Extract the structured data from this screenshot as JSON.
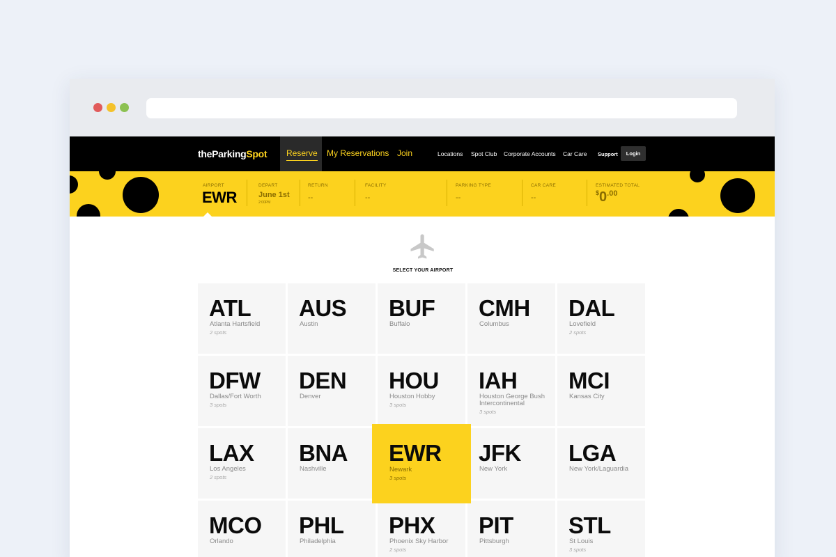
{
  "header": {
    "logo_part1": "theParking",
    "logo_part2": "Spot",
    "nav": {
      "reserve": "Reserve",
      "my_reservations": "My Reservations",
      "join": "Join"
    },
    "subnav": {
      "locations": "Locations",
      "spot_club": "Spot Club",
      "corporate": "Corporate Accounts",
      "car_care": "Car Care"
    },
    "support": "Support",
    "login": "Login"
  },
  "booking_bar": {
    "airport_label": "AIRPORT",
    "airport_value": "EWR",
    "depart_label": "DEPART",
    "depart_date": "June 1st",
    "depart_time": "2:00PM",
    "return_label": "RETURN",
    "return_value": "--",
    "facility_label": "FACILITY",
    "facility_value": "--",
    "parking_type_label": "PARKING TYPE",
    "parking_type_value": "--",
    "car_care_label": "CAR CARE",
    "car_care_value": "--",
    "total_label": "ESTIMATED TOTAL",
    "total_symbol": "$",
    "total_whole": "0",
    "total_cents": ".00"
  },
  "main": {
    "icon": "airplane-icon",
    "title": "SELECT YOUR AIRPORT",
    "airports": [
      {
        "code": "ATL",
        "city": "Atlanta Hartsfield",
        "spots": "2 spots"
      },
      {
        "code": "AUS",
        "city": "Austin",
        "spots": ""
      },
      {
        "code": "BUF",
        "city": "Buffalo",
        "spots": ""
      },
      {
        "code": "CMH",
        "city": "Columbus",
        "spots": ""
      },
      {
        "code": "DAL",
        "city": "Lovefield",
        "spots": "2 spots"
      },
      {
        "code": "DFW",
        "city": "Dallas/Fort Worth",
        "spots": "3 spots"
      },
      {
        "code": "DEN",
        "city": "Denver",
        "spots": ""
      },
      {
        "code": "HOU",
        "city": "Houston Hobby",
        "spots": "3 spots"
      },
      {
        "code": "IAH",
        "city": "Houston George Bush Intercontinental",
        "spots": "3 spots"
      },
      {
        "code": "MCI",
        "city": "Kansas City",
        "spots": ""
      },
      {
        "code": "LAX",
        "city": "Los Angeles",
        "spots": "2 spots"
      },
      {
        "code": "BNA",
        "city": "Nashville",
        "spots": ""
      },
      {
        "code": "EWR",
        "city": "Newark",
        "spots": "3 spots",
        "selected": true
      },
      {
        "code": "JFK",
        "city": "New York",
        "spots": ""
      },
      {
        "code": "LGA",
        "city": "New York/Laguardia",
        "spots": ""
      },
      {
        "code": "MCO",
        "city": "Orlando",
        "spots": ""
      },
      {
        "code": "PHL",
        "city": "Philadelphia",
        "spots": ""
      },
      {
        "code": "PHX",
        "city": "Phoenix Sky Harbor",
        "spots": "2 spots"
      },
      {
        "code": "PIT",
        "city": "Pittsburgh",
        "spots": ""
      },
      {
        "code": "STL",
        "city": "St Louis",
        "spots": "3 spots"
      }
    ]
  },
  "colors": {
    "accent": "#fcd21e",
    "nav_bg": "#000000",
    "tile_bg": "#f6f6f6"
  }
}
